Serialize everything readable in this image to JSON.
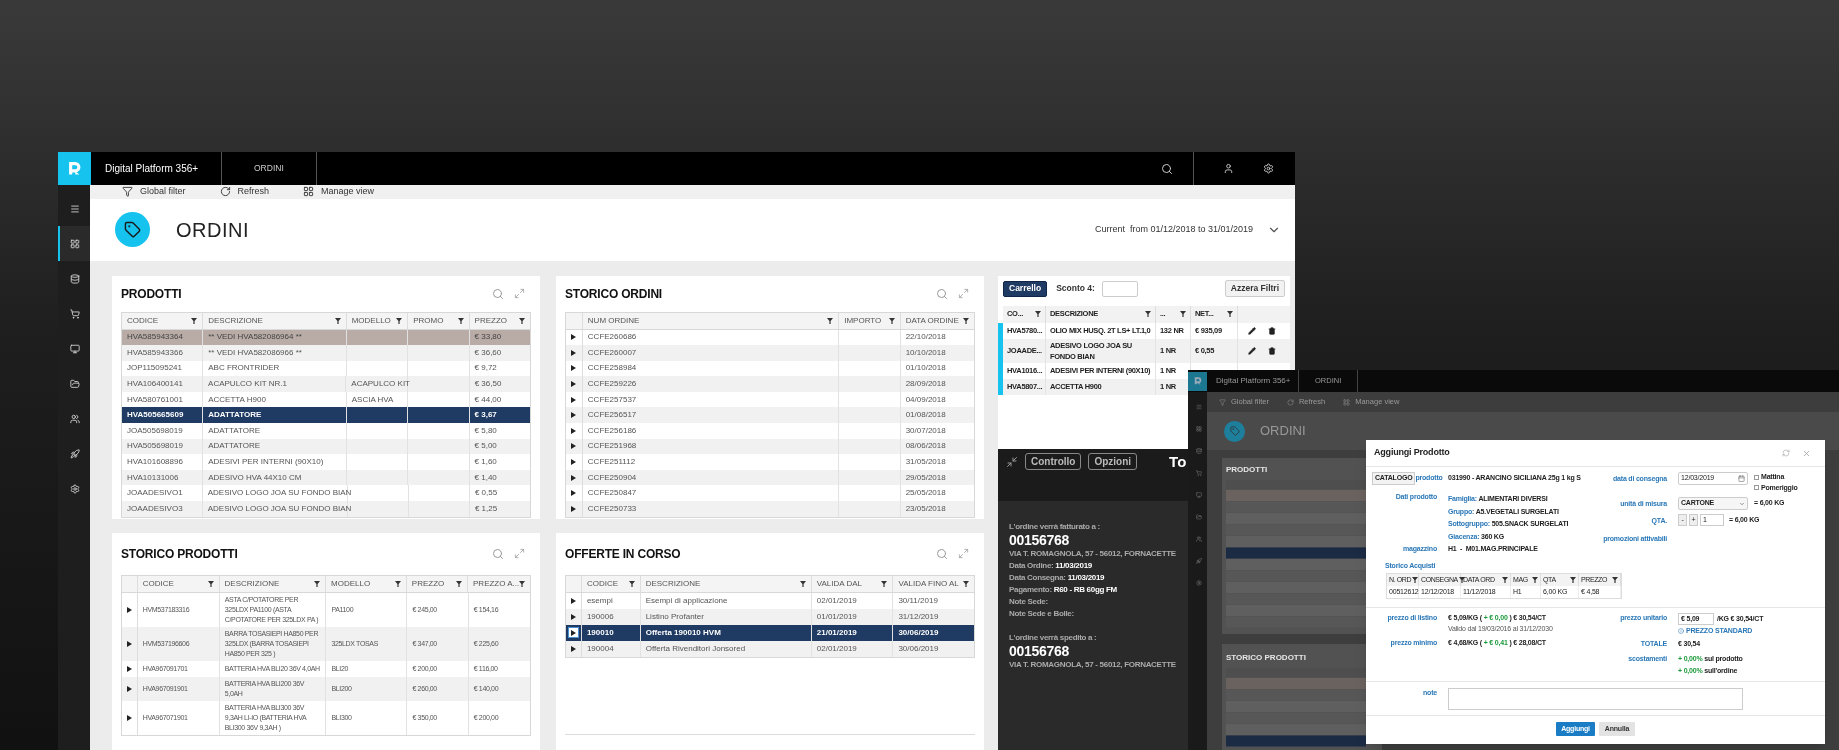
{
  "main_window": {
    "app_title": "Digital Platform 356+",
    "tab": "ORDINI",
    "sidebar_items": [
      {
        "kind": "menu",
        "selected": false
      },
      {
        "kind": "dashboard",
        "selected": true
      },
      {
        "kind": "database",
        "selected": false
      },
      {
        "kind": "cart",
        "selected": false
      },
      {
        "kind": "monitor",
        "selected": false
      },
      {
        "kind": "folder",
        "selected": false
      },
      {
        "kind": "users",
        "selected": false
      },
      {
        "kind": "rocket",
        "selected": false
      },
      {
        "kind": "settings",
        "selected": false
      }
    ],
    "toolbar": [
      {
        "kind": "filter",
        "label": "Global filter"
      },
      {
        "kind": "refresh",
        "label": "Refresh"
      },
      {
        "kind": "layout",
        "label": "Manage view"
      }
    ],
    "page_title": "ORDINI",
    "period": "Current  from 01/12/2018 to 31/01/2019",
    "prodotti": {
      "title": "PRODOTTI",
      "columns": [
        "CODICE",
        "DESCRIZIONE",
        "MODELLO",
        "PROMO",
        "PREZZO"
      ],
      "rows": [
        {
          "codice": "HVA585943364",
          "descrizione": "** VEDI HVA582086964 **",
          "prezzo": "€ 33,80",
          "selected": false,
          "hovered": true
        },
        {
          "codice": "HVA585943366",
          "descrizione": "** VEDI HVA582086966 **",
          "prezzo": "€ 36,60",
          "selected": false,
          "hovered": false
        },
        {
          "codice": "JOP115095241",
          "descrizione": "ABC FRONTRIDER",
          "prezzo": "€ 9,72",
          "selected": false,
          "hovered": false
        },
        {
          "codice": "HVA106400141",
          "descrizione": "ACAPULCO KIT NR.1",
          "modello": "ACAPULCO KIT",
          "prezzo": "€ 36,50",
          "selected": false,
          "hovered": false
        },
        {
          "codice": "HVA580761001",
          "descrizione": "ACCETTA H900",
          "modello": "ASCIA HVA",
          "prezzo": "€ 44,00",
          "selected": false,
          "hovered": false
        },
        {
          "codice": "HVA505665609",
          "descrizione": "ADATTATORE",
          "prezzo": "€ 3,67",
          "selected": true,
          "hovered": false
        },
        {
          "codice": "JOA505698019",
          "descrizione": "ADATTATORE",
          "prezzo": "€ 5,80",
          "selected": false,
          "hovered": false
        },
        {
          "codice": "HVA505698019",
          "descrizione": "ADATTATORE",
          "prezzo": "€ 5,00",
          "selected": false,
          "hovered": false
        },
        {
          "codice": "HVA101608896",
          "descrizione": "ADESIVI PER INTERNI (90X10)",
          "prezzo": "€ 1,60",
          "selected": false,
          "hovered": false
        },
        {
          "codice": "HVA10131006",
          "descrizione": "ADESIVO HVA 44X10 CM",
          "prezzo": "€ 1,40",
          "selected": false,
          "hovered": false
        },
        {
          "codice": "JOAADESIVO1",
          "descrizione": "ADESIVO LOGO JOA SU FONDO BIAN",
          "prezzo": "€ 0,55",
          "selected": false,
          "hovered": false
        },
        {
          "codice": "JOAADESIVO3",
          "descrizione": "ADESIVO LOGO JOA SU FONDO BIAN",
          "prezzo": "€ 1,25",
          "selected": false,
          "hovered": false
        }
      ]
    },
    "storico_ordini": {
      "title": "STORICO ORDINI",
      "columns": [
        "NUM ORDINE",
        "IMPORTO",
        "DATA ORDINE"
      ],
      "rows": [
        {
          "num": "CCFE260686",
          "data": "22/10/2018"
        },
        {
          "num": "CCFE260007",
          "data": "10/10/2018"
        },
        {
          "num": "CCFE258984",
          "data": "01/10/2018"
        },
        {
          "num": "CCFE259226",
          "data": "28/09/2018"
        },
        {
          "num": "CCFE257537",
          "data": "04/09/2018"
        },
        {
          "num": "CCFE256517",
          "data": "01/08/2018"
        },
        {
          "num": "CCFE256186",
          "data": "30/07/2018"
        },
        {
          "num": "CCFE251968",
          "data": "08/06/2018"
        },
        {
          "num": "CCFE251112",
          "data": "31/05/2018"
        },
        {
          "num": "CCFE250904",
          "data": "29/05/2018"
        },
        {
          "num": "CCFE250847",
          "data": "25/05/2018"
        },
        {
          "num": "CCFE250733",
          "data": "23/05/2018"
        }
      ]
    },
    "storico_prodotti": {
      "title": "STORICO PRODOTTI",
      "columns": [
        "CODICE",
        "DESCRIZIONE",
        "MODELLO",
        "PREZZO",
        "PREZZO A..."
      ],
      "rows": [
        {
          "codice": "HVM537183316",
          "descrizione": "ASTA C/POTATORE PER 325LDX PA1100 (ASTA C/POTATORE PER 325LDX PA )",
          "modello": "PA1100",
          "prezzo": "€ 245,00",
          "prezzo_a": "€ 154,16"
        },
        {
          "codice": "HVM537196606",
          "descrizione": "BARRA TOSASIEPI HA850 PER 325LDX (BARRA TOSASIEPI HA850 PER 325 )",
          "modello": "325LDX TOSAS",
          "prezzo": "€ 347,00",
          "prezzo_a": "€ 225,60"
        },
        {
          "codice": "HVA967091701",
          "descrizione": "BATTERIA HVA BLI20 36V 4,0AH",
          "modello": "BLI20",
          "prezzo": "€ 200,00",
          "prezzo_a": "€ 116,00"
        },
        {
          "codice": "HVA967091901",
          "descrizione": "BATTERIA HVA BLI200 36V 5,0AH",
          "modello": "BLI200",
          "prezzo": "€ 260,00",
          "prezzo_a": "€ 140,00"
        },
        {
          "codice": "HVA967071901",
          "descrizione": "BATTERIA HVA BLI300 36V 9,3AH LI-IO (BATTERIA HVA BLI300 36V 9,3AH )",
          "modello": "BLI300",
          "prezzo": "€ 350,00",
          "prezzo_a": "€ 200,00"
        }
      ]
    },
    "offerte": {
      "title": "OFFERTE IN CORSO",
      "columns": [
        "CODICE",
        "DESCRIZIONE",
        "VALIDA DAL",
        "VALIDA FINO AL"
      ],
      "rows": [
        {
          "codice": "esempi",
          "descrizione": "Esempi di applicazione",
          "dal": "02/01/2019",
          "al": "30/11/2019",
          "selected": false
        },
        {
          "codice": "190006",
          "descrizione": "Listino Profanter",
          "dal": "01/01/2019",
          "al": "31/12/2019",
          "selected": false
        },
        {
          "codice": "190010",
          "descrizione": "Offerta 190010 HVM",
          "dal": "21/01/2019",
          "al": "30/06/2019",
          "selected": true
        },
        {
          "codice": "190004",
          "descrizione": "Offerta Rivenditori Jonsored",
          "dal": "02/01/2019",
          "al": "30/06/2019",
          "selected": false
        }
      ]
    },
    "cart": {
      "button": "Carrello",
      "discount_label": "Sconto 4:",
      "reset_button": "Azzera Filtri",
      "columns": [
        "CO...",
        "DESCRIZIONE",
        "...",
        "NET..."
      ],
      "rows": [
        {
          "code": "HVA5780...",
          "desc": "OLIO MIX HUSQ. 2T LS+ LT.1,0",
          "qty": "132 NR",
          "net": "€ 935,09",
          "editable": true
        },
        {
          "code": "JOAADE...",
          "desc": "ADESIVO LOGO JOA SU FONDO BIAN",
          "qty": "1 NR",
          "net": "€ 0,55",
          "editable": true
        },
        {
          "code": "HVA1016...",
          "desc": "ADESIVI PER INTERNI (90X10)",
          "qty": "1 NR"
        },
        {
          "code": "HVA5807...",
          "desc": "ACCETTA H900",
          "qty": "1 NR"
        }
      ]
    },
    "summary": {
      "buttons": [
        "Controllo",
        "Opzioni"
      ],
      "total_label": "To",
      "billing_label": "L'ordine verrà fatturato a :",
      "billing_code": "00156768",
      "billing_address": "VIA T. ROMAGNOLA, 57 - 56012, FORNACETTE",
      "details": [
        "Data Ordine: **11/03/2019**",
        "Data Consegna: **11/03/2019**",
        "Pagamento: **R60 - RB 60gg FM**",
        "Note Sede:",
        "Note Sede e Bolle:"
      ],
      "shipping_label": "L'ordine verrà spedito a :",
      "shipping_code": "00156768",
      "shipping_address": "VIA T. ROMAGNOLA, 57 - 56012, FORNACETTE"
    }
  },
  "overlay_window": {
    "app_title": "Digital Platform 356+",
    "tab": "ORDINI",
    "sidebar_items": [
      {
        "kind": "menu",
        "selected": false
      },
      {
        "kind": "dashboard",
        "selected": false
      },
      {
        "kind": "database",
        "selected": false
      },
      {
        "kind": "cart",
        "selected": false
      },
      {
        "kind": "monitor",
        "selected": false
      },
      {
        "kind": "folder",
        "selected": false
      },
      {
        "kind": "users",
        "selected": false
      },
      {
        "kind": "rocket",
        "selected": false
      },
      {
        "kind": "settings",
        "selected": false
      }
    ],
    "toolbar": [
      {
        "kind": "filter",
        "label": "Global filter"
      },
      {
        "kind": "refresh",
        "label": "Refresh"
      },
      {
        "kind": "layout",
        "label": "Manage view"
      }
    ],
    "page_title": "ORDINI",
    "sections": [
      "PRODOTTI",
      "STORICO PRODOTTI"
    ]
  },
  "dialog": {
    "title": "Aggiungi Prodotto",
    "catalog_button": "CATALOGO",
    "product_label": "prodotto",
    "product_value": "031990 - ARANCINO SICILIANA 25g 1 kg S",
    "details_label": "Dati prodotto",
    "details": [
      {
        "label": "Famiglia:",
        "value": "ALIMENTARI DIVERSI"
      },
      {
        "label": "Gruppo:",
        "value": "A5.VEGETALI SURGELATI"
      },
      {
        "label": "Sottogruppo:",
        "value": "505.SNACK SURGELATI"
      },
      {
        "label": "Giacenza:",
        "value": "360 KG"
      }
    ],
    "warehouse_label": "magazzino",
    "warehouse_value": "H1  -  M01.MAG.PRINCIPALE",
    "delivery_label": "data di consegna",
    "delivery_date": "12/03/2019",
    "slots": [
      {
        "label": "Mattina",
        "checked": false
      },
      {
        "label": "Pomeriggio",
        "checked": false
      }
    ],
    "unit_label": "unità di misura",
    "unit_value": "CARTONE",
    "unit_equiv": "= 6,00 KG",
    "qty_label": "QTA.",
    "qty_minus": "-",
    "qty_plus": "+",
    "qty_value": "1",
    "qty_equiv": "= 6,00 KG",
    "promo_label": "promozioni attivabili",
    "history_label": "Storico Acquisti",
    "history_columns": [
      "N. ORD",
      "CONSEGNA",
      "DATA ORD",
      "MAG",
      "QTA",
      "PREZZO"
    ],
    "history_rows": [
      [
        "00512612",
        "12/12/2018",
        "11/12/2018",
        "H1",
        "6,00 KG",
        "€ 4,58"
      ]
    ],
    "list_price_label": "prezzo di listino",
    "list_price": {
      "before": "€ 5,09/KG (",
      "delta": "+ € 0,00",
      "after": ") € 30,54/CT"
    },
    "validity": "Valido dal 19/03/2016 al 31/12/2030",
    "min_price_label": "prezzo minimo",
    "min_price": {
      "before": "€ 4,68/KG (",
      "delta": "+ € 0,41",
      "after": ") € 28,08/CT"
    },
    "unit_price_label": "prezzo unitario",
    "unit_price_value": "€ 5,09",
    "unit_price_suffix": "/KG € 30,54/CT",
    "standard_price": "PREZZO STANDARD",
    "total_label": "TOTALE",
    "total_value": "€ 30,54",
    "deviation_label": "scostamenti",
    "deviations": [
      {
        "delta": "+ 0,00%",
        "text": "sul prodotto"
      },
      {
        "delta": "+ 0,00%",
        "text": "sull'ordine"
      }
    ],
    "note_label": "note",
    "confirm_button": "Aggiungi",
    "cancel_button": "Annulla"
  }
}
